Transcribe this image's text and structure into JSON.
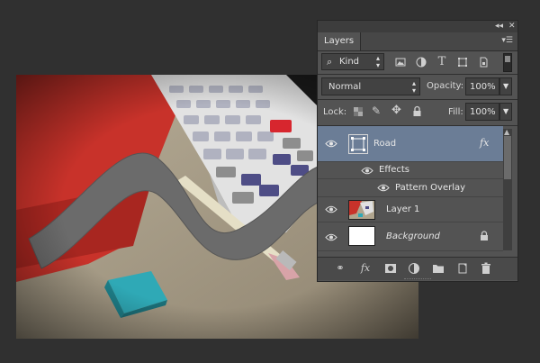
{
  "panel": {
    "tab_label": "Layers",
    "filter": {
      "value": "Kind",
      "search_glyph": "⌕"
    },
    "blend_mode": "Normal",
    "opacity_label": "Opacity:",
    "opacity_value": "100%",
    "lock_label": "Lock:",
    "fill_label": "Fill:",
    "fill_value": "100%",
    "layers": [
      {
        "name": "Road",
        "fx": "fx",
        "selected": true
      },
      {
        "name": "Effects"
      },
      {
        "name": "Pattern Overlay"
      },
      {
        "name": "Layer 1"
      },
      {
        "name": "Background",
        "italic": true,
        "locked": true
      }
    ],
    "footer_fx": "fx"
  },
  "colors": {
    "panel_bg": "#535353",
    "selected_row": "#6b7d96",
    "workspace": "#303030"
  },
  "icons": [
    "collapse-icon",
    "close-icon",
    "panel-menu-icon",
    "search-icon",
    "image-filter-icon",
    "adjustment-filter-icon",
    "type-filter-icon",
    "shape-filter-icon",
    "smart-object-filter-icon",
    "eye-icon",
    "lock-icon",
    "link-icon",
    "mask-icon",
    "new-fill-icon",
    "folder-icon",
    "new-layer-icon",
    "trash-icon"
  ]
}
